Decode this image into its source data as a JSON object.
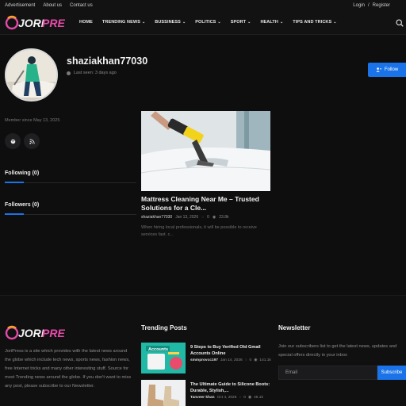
{
  "topbar": {
    "links": [
      "Advertisement",
      "About us",
      "Contact us"
    ],
    "login": "Login",
    "separator": "/",
    "register": "Register"
  },
  "nav": {
    "logo_text": "JORI PRESS",
    "items": [
      {
        "label": "HOME",
        "has_dropdown": false
      },
      {
        "label": "TRENDING NEWS",
        "has_dropdown": true
      },
      {
        "label": "BUSSINESS",
        "has_dropdown": true
      },
      {
        "label": "POLITICS",
        "has_dropdown": true
      },
      {
        "label": "SPORT",
        "has_dropdown": true
      },
      {
        "label": "HEALTH",
        "has_dropdown": true
      },
      {
        "label": "TIPS AND TRICKS",
        "has_dropdown": true
      }
    ],
    "search_icon": "search-icon"
  },
  "profile": {
    "username": "shaziakhan77030",
    "last_seen": "Last seen: 3 days ago",
    "follow_label": "Follow",
    "member_since": "Member since May 13, 2025",
    "social_icons": [
      "globe-icon",
      "rss-icon"
    ],
    "following": "Following (0)",
    "followers": "Followers (0)"
  },
  "post": {
    "title": "Mattress Cleaning Near Me – Trusted Solutions for a Cle...",
    "author": "shaziakhan77030",
    "date": "Jan 13, 2026",
    "comments": "0",
    "views": "23.8k",
    "excerpt": "When hiring local professionals, it will be possible to receive services fast. c..."
  },
  "footer": {
    "logo_text": "JORI PRESS",
    "about": "JoriPress is a site which provides with the latest news around the globe which include tech news, sports news, fashion news, free Internet tricks and many other interesting stuff. Source for most Trending news around the globe. If you don't want to miss any post, please subscribe to our Newsletter.",
    "trending_heading": "Trending Posts",
    "trending": [
      {
        "title": "9 Steps to Buy Verified Old Gmail Accounts Online",
        "author": "smmprovcc197",
        "date": "Jan 14, 2026",
        "comments": "0",
        "views": "141.1k",
        "thumb_label": "Accounts"
      },
      {
        "title": "The Ultimate Guide to Silicone Boots: Durable, Stylish,...",
        "author": "Tanveer khan",
        "date": "Oct 4, 2025",
        "comments": "0",
        "views": "45.1k",
        "thumb_label": ""
      }
    ],
    "newsletter_heading": "Newsletter",
    "newsletter_text": "Join our subscribers list to get the latest news, updates and special offers directly in your inbox",
    "email_placeholder": "Email",
    "subscribe_label": "Subscribe"
  },
  "colors": {
    "accent": "#1a73e8",
    "background": "#0e0e0f"
  }
}
